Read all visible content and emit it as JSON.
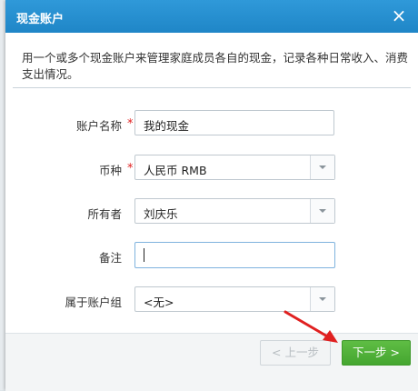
{
  "dialog": {
    "title": "现金账户",
    "close_glyph": "×",
    "description": "用一个或多个现金账户来管理家庭成员各自的现金，记录各种日常收入、消费支出情况。"
  },
  "form": {
    "account_name": {
      "label": "账户名称",
      "required_mark": "*",
      "value": "我的现金"
    },
    "currency": {
      "label": "币种",
      "required_mark": "*",
      "value": "人民币 RMB"
    },
    "owner": {
      "label": "所有者",
      "value": "刘庆乐"
    },
    "note": {
      "label": "备注",
      "value": ""
    },
    "group": {
      "label": "属于账户组",
      "value": "<无>"
    }
  },
  "footer": {
    "prev_label": "< 上一步",
    "next_label": "下一步 >"
  },
  "colors": {
    "titlebar": "#2f99d9",
    "next_button": "#4fb13a",
    "required": "#e02020",
    "annotation_arrow": "#e02020"
  },
  "icons": {
    "close": "close-icon",
    "dropdown": "chevron-down-icon",
    "annotation": "red-arrow-icon"
  }
}
